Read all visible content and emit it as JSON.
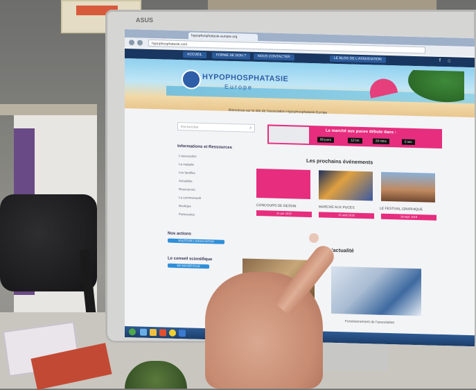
{
  "browser": {
    "tab_title": "hypophosphatasie-europe.org",
    "address": "hypophosphatasie.com"
  },
  "site": {
    "nav": [
      "ACCUEIL",
      "FORME DE DON ?",
      "NOUS CONTACTER",
      "LE BLOG DE L'ASSOCIATION"
    ],
    "logo_title": "HYPOPHOSPHATASIE",
    "logo_sub": "Europe",
    "breadcrumb": "Bienvenue sur le site de l'association Hypophosphatasie Europe",
    "search_placeholder": "Rechercher",
    "sidebar_heading": "Informations et Ressources",
    "sidebar_items": [
      "L'association",
      "La maladie",
      "Les familles",
      "Actualités",
      "Ressources",
      "La communauté",
      "Boutique",
      "Partenaires"
    ],
    "sidebar_section2": "Nos actions",
    "sidebar_btn2": "SOUTENIR L'ASSOCIATION",
    "sidebar_section3": "Le conseil scientifique",
    "sidebar_btn3": "EN SAVOIR PLUS",
    "banner_title": "Le marché aux puces débute dans :",
    "countdown": [
      "00 jours",
      "12 hrs",
      "29 mins",
      "0 sec"
    ],
    "events_heading": "Les prochains événements",
    "events": [
      {
        "title": "CONCOURS DE DESSIN",
        "date": "31 juil. 2015"
      },
      {
        "title": "MARCHE AUX PUCES",
        "date": "22 août 2015"
      },
      {
        "title": "LE FESTIVAL GRAPHIQUE",
        "date": "19 sept. 2015"
      }
    ],
    "news_heading": "L'actualité",
    "news_caption": "Fonctionnement de l'association"
  }
}
